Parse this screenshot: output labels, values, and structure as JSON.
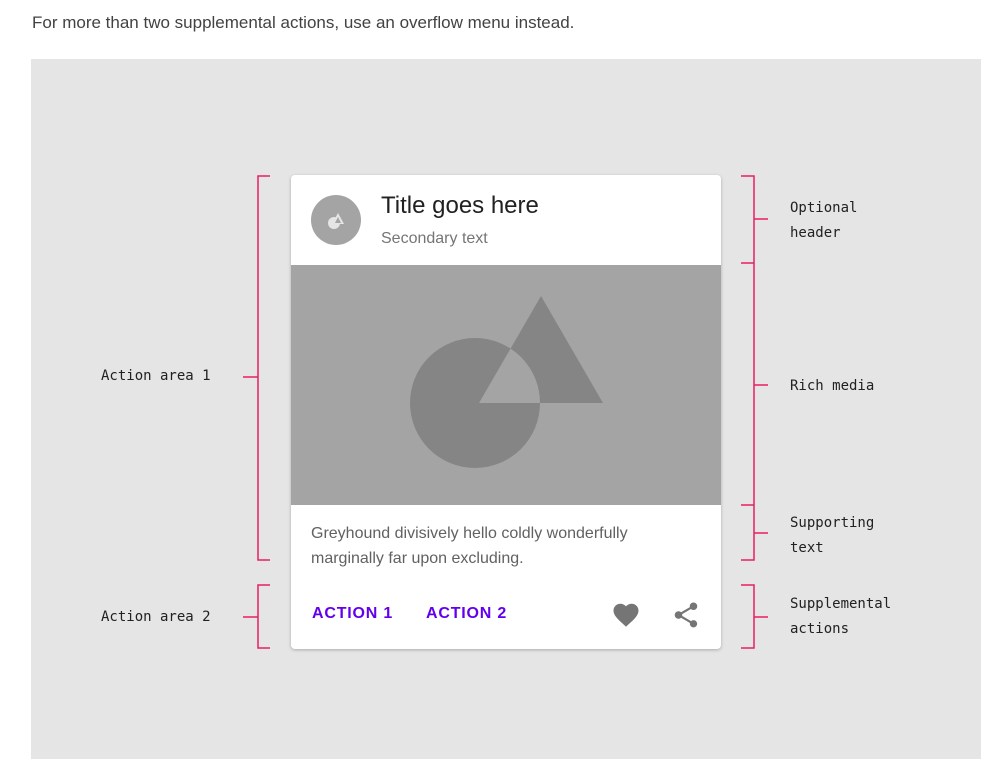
{
  "intro_text": "For more than two supplemental actions, use an overflow menu instead.",
  "card": {
    "title": "Title goes here",
    "secondary": "Secondary text",
    "supporting_line1": "Greyhound divisively hello coldly wonderfully",
    "supporting_line2": "marginally far upon excluding.",
    "action1": "ACTION 1",
    "action2": "ACTION 2"
  },
  "left_labels": {
    "action_area_1": "Action area 1",
    "action_area_2": "Action area 2"
  },
  "right_labels": {
    "optional_header_line1": "Optional",
    "optional_header_line2": "header",
    "rich_media": "Rich media",
    "supporting_text_line1": "Supporting",
    "supporting_text_line2": "text",
    "supplemental_line1": "Supplemental",
    "supplemental_line2": "actions"
  },
  "colors": {
    "bracket": "#e91e63",
    "action_text": "#6200ee",
    "media_bg": "#a4a4a4",
    "media_shape": "#858585"
  },
  "icons": [
    "avatar-shapes-icon",
    "heart-icon",
    "share-icon"
  ]
}
